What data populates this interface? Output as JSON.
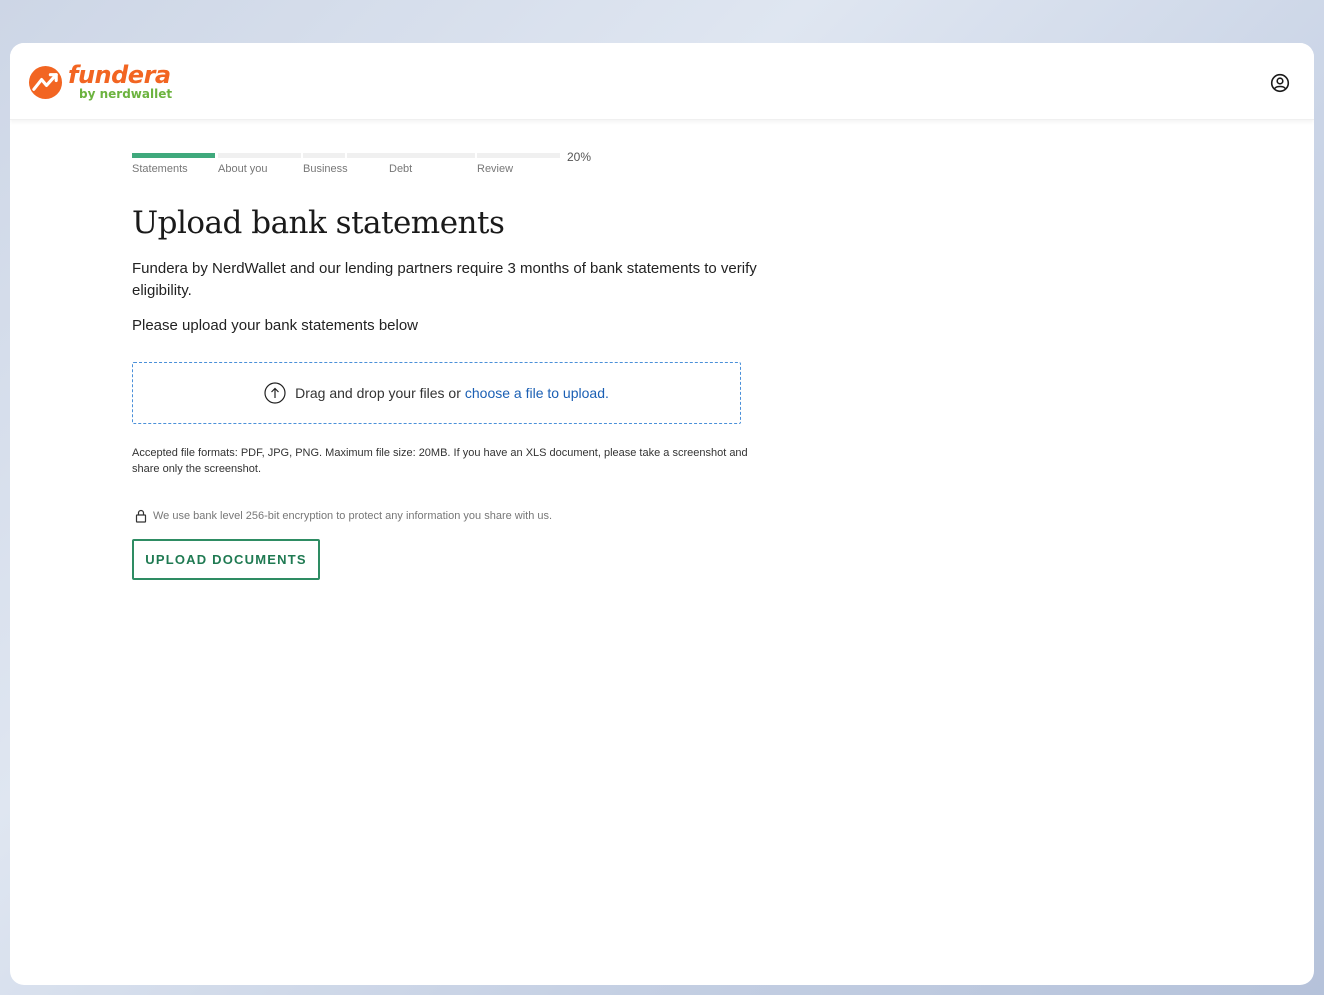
{
  "brand": {
    "name": "fundera",
    "subtitle": "by nerdwallet",
    "primary_color": "#f26522",
    "secondary_color": "#6cb33f"
  },
  "header": {
    "account_icon": "user-circle-icon"
  },
  "progress": {
    "percent_label": "20%",
    "percent_value": 20,
    "steps": [
      {
        "label": "Statements",
        "active": true
      },
      {
        "label": "About you",
        "active": false
      },
      {
        "label": "Business",
        "active": false
      },
      {
        "label": "",
        "active": false
      },
      {
        "label": "Debt",
        "active": false
      },
      {
        "label": "Review",
        "active": false
      }
    ],
    "active_color": "#3fa97c"
  },
  "page": {
    "title": "Upload bank statements",
    "intro": "Fundera by NerdWallet and our lending partners require 3 months of bank statements to verify eligibility.",
    "instruction": "Please upload your bank statements below"
  },
  "dropzone": {
    "icon": "upload-arrow-icon",
    "text": "Drag and drop your files or",
    "link_text": "choose a file to upload."
  },
  "formats_note": "Accepted file formats: PDF, JPG, PNG. Maximum file size: 20MB. If you have an XLS document, please take a screenshot and share only the screenshot.",
  "security": {
    "icon": "lock-icon",
    "text": "We use bank level 256-bit encryption to protect any information you share with us."
  },
  "actions": {
    "upload_label": "UPLOAD DOCUMENTS",
    "accent_color": "#2e8c63"
  }
}
